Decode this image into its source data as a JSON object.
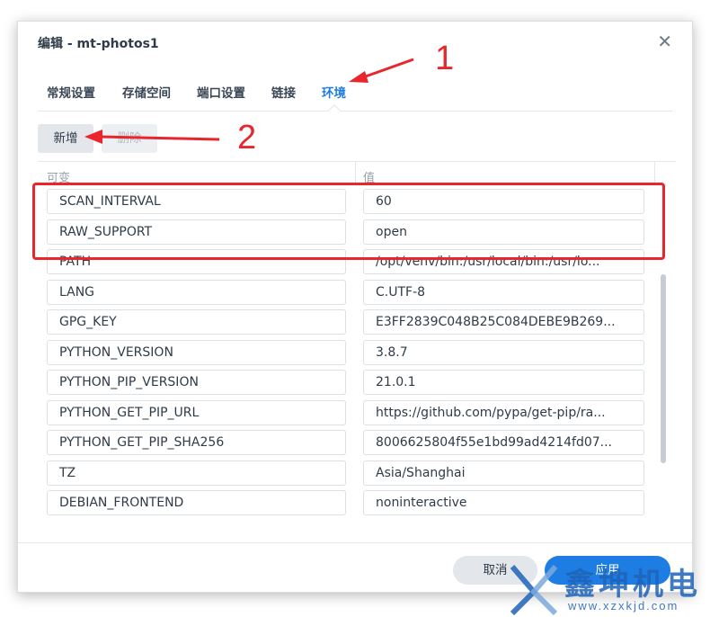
{
  "dialog": {
    "title": "编辑 - mt-photos1",
    "close_glyph": "✕"
  },
  "tabs": [
    {
      "label": "常规设置",
      "active": false
    },
    {
      "label": "存储空间",
      "active": false
    },
    {
      "label": "端口设置",
      "active": false
    },
    {
      "label": "链接",
      "active": false
    },
    {
      "label": "环境",
      "active": true
    }
  ],
  "toolbar": {
    "add_label": "新增",
    "delete_label": "删除"
  },
  "grid": {
    "columns": [
      "可变",
      "值"
    ],
    "rows": [
      {
        "variable": "SCAN_INTERVAL",
        "value": "60"
      },
      {
        "variable": "RAW_SUPPORT",
        "value": "open"
      },
      {
        "variable": "PATH",
        "value": "/opt/venv/bin:/usr/local/bin:/usr/lo..."
      },
      {
        "variable": "LANG",
        "value": "C.UTF-8"
      },
      {
        "variable": "GPG_KEY",
        "value": "E3FF2839C048B25C084DEBE9B269..."
      },
      {
        "variable": "PYTHON_VERSION",
        "value": "3.8.7"
      },
      {
        "variable": "PYTHON_PIP_VERSION",
        "value": "21.0.1"
      },
      {
        "variable": "PYTHON_GET_PIP_URL",
        "value": "https://github.com/pypa/get-pip/ra..."
      },
      {
        "variable": "PYTHON_GET_PIP_SHA256",
        "value": "8006625804f55e1bd99ad4214fd07..."
      },
      {
        "variable": "TZ",
        "value": "Asia/Shanghai"
      },
      {
        "variable": "DEBIAN_FRONTEND",
        "value": "noninteractive"
      }
    ]
  },
  "footer": {
    "cancel_label": "取消",
    "apply_label": "应用"
  },
  "annotations": {
    "step1": "1",
    "step2": "2",
    "color": "#e8262b"
  },
  "watermark": {
    "cn": "鑫坤机电",
    "url": "www.xzxkjd.com"
  },
  "colors": {
    "accent": "#1e7de3",
    "annotation": "#e8262b"
  }
}
